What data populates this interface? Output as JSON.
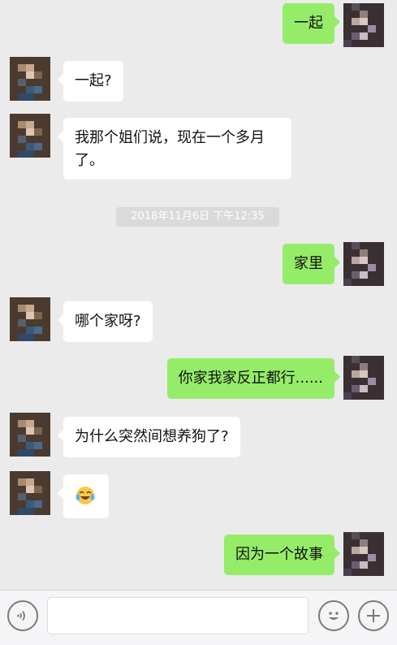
{
  "messages": [
    {
      "side": "out",
      "text": "一起"
    },
    {
      "side": "in",
      "text": "一起?"
    },
    {
      "side": "in",
      "text": "我那个姐们说，现在一个多月了。"
    },
    {
      "side": "out",
      "text": "家里"
    },
    {
      "side": "in",
      "text": "哪个家呀?"
    },
    {
      "side": "out",
      "text": "你家我家反正都行......"
    },
    {
      "side": "in",
      "text": "为什么突然间想养狗了?"
    },
    {
      "side": "in",
      "text": "😂"
    },
    {
      "side": "out",
      "text": "因为一个故事"
    }
  ],
  "timestamp": "2018年11月6日 下午12:35",
  "composer": {
    "value": "",
    "placeholder": ""
  },
  "icons": {
    "voice": "voice-icon",
    "emoji": "emoji-icon",
    "plus": "plus-icon"
  },
  "colors": {
    "background": "#ebebeb",
    "outgoing_bubble": "#95ec69",
    "incoming_bubble": "#ffffff",
    "timestamp_bg": "#dadada"
  }
}
